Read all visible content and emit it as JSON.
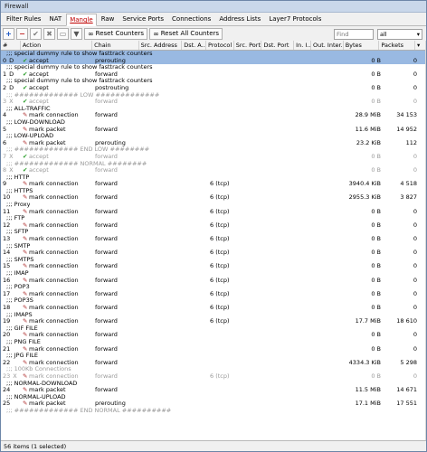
{
  "window": {
    "title": "Firewall"
  },
  "tabs": [
    "Filter Rules",
    "NAT",
    "Mangle",
    "Raw",
    "Service Ports",
    "Connections",
    "Address Lists",
    "Layer7 Protocols"
  ],
  "active_tab": "Mangle",
  "toolbar": {
    "reset_counters": "Reset Counters",
    "reset_all_counters": "Reset All Counters",
    "find_placeholder": "Find",
    "filter_value": "all"
  },
  "columns": [
    "#",
    "Action",
    "Chain",
    "Src. Address",
    "Dst. A...",
    "Protocol",
    "Src. Port",
    "Dst. Port",
    "In. I...",
    "Out. Inter...",
    "Bytes",
    "Packets"
  ],
  "rows": [
    {
      "type": "comment",
      "text": ";;; special dummy rule to show fasttrack counters",
      "selected": true
    },
    {
      "type": "rule",
      "num": "0",
      "flag": "D",
      "icon": "check",
      "action": "accept",
      "chain": "prerouting",
      "proto": "",
      "bytes": "0 B",
      "packets": "0",
      "selected": true
    },
    {
      "type": "comment",
      "text": ";;; special dummy rule to show fasttrack counters"
    },
    {
      "type": "rule",
      "num": "1",
      "flag": "D",
      "icon": "check",
      "action": "accept",
      "chain": "forward",
      "proto": "",
      "bytes": "0 B",
      "packets": "0"
    },
    {
      "type": "comment",
      "text": ";;; special dummy rule to show fasttrack counters"
    },
    {
      "type": "rule",
      "num": "2",
      "flag": "D",
      "icon": "check",
      "action": "accept",
      "chain": "postrouting",
      "proto": "",
      "bytes": "0 B",
      "packets": "0"
    },
    {
      "type": "comment",
      "text": ";;; ############# LOW #############",
      "disabled": true
    },
    {
      "type": "rule",
      "num": "3",
      "flag": "X",
      "icon": "check",
      "action": "accept",
      "chain": "forward",
      "proto": "",
      "bytes": "0 B",
      "packets": "0",
      "disabled": true
    },
    {
      "type": "comment",
      "text": ";;; ALL-TRAFFIC"
    },
    {
      "type": "rule",
      "num": "4",
      "flag": "",
      "icon": "pen",
      "action": "mark connection",
      "chain": "forward",
      "proto": "",
      "bytes": "28.9 MiB",
      "packets": "34 153"
    },
    {
      "type": "comment",
      "text": ";;; LOW-DOWNLOAD"
    },
    {
      "type": "rule",
      "num": "5",
      "flag": "",
      "icon": "pen",
      "action": "mark packet",
      "chain": "forward",
      "proto": "",
      "bytes": "11.6 MiB",
      "packets": "14 952"
    },
    {
      "type": "comment",
      "text": ";;; LOW-UPLOAD"
    },
    {
      "type": "rule",
      "num": "6",
      "flag": "",
      "icon": "pen",
      "action": "mark packet",
      "chain": "prerouting",
      "proto": "",
      "bytes": "23.2 KiB",
      "packets": "112"
    },
    {
      "type": "comment",
      "text": ";;; ############# END LOW ########",
      "disabled": true
    },
    {
      "type": "rule",
      "num": "7",
      "flag": "X",
      "icon": "check",
      "action": "accept",
      "chain": "forward",
      "proto": "",
      "bytes": "0 B",
      "packets": "0",
      "disabled": true
    },
    {
      "type": "comment",
      "text": ";;; ############# NORMAL ########",
      "disabled": true
    },
    {
      "type": "rule",
      "num": "8",
      "flag": "X",
      "icon": "check",
      "action": "accept",
      "chain": "forward",
      "proto": "",
      "bytes": "0 B",
      "packets": "0",
      "disabled": true
    },
    {
      "type": "comment",
      "text": ";;; HTTP"
    },
    {
      "type": "rule",
      "num": "9",
      "flag": "",
      "icon": "pen",
      "action": "mark connection",
      "chain": "forward",
      "proto": "6 (tcp)",
      "bytes": "3940.4 KiB",
      "packets": "4 518"
    },
    {
      "type": "comment",
      "text": ";;; HTTPS"
    },
    {
      "type": "rule",
      "num": "10",
      "flag": "",
      "icon": "pen",
      "action": "mark connection",
      "chain": "forward",
      "proto": "6 (tcp)",
      "bytes": "2955.3 KiB",
      "packets": "3 827"
    },
    {
      "type": "comment",
      "text": ";;; Proxy"
    },
    {
      "type": "rule",
      "num": "11",
      "flag": "",
      "icon": "pen",
      "action": "mark connection",
      "chain": "forward",
      "proto": "6 (tcp)",
      "bytes": "0 B",
      "packets": "0"
    },
    {
      "type": "comment",
      "text": ";;; FTP"
    },
    {
      "type": "rule",
      "num": "12",
      "flag": "",
      "icon": "pen",
      "action": "mark connection",
      "chain": "forward",
      "proto": "6 (tcp)",
      "bytes": "0 B",
      "packets": "0"
    },
    {
      "type": "comment",
      "text": ";;; SFTP"
    },
    {
      "type": "rule",
      "num": "13",
      "flag": "",
      "icon": "pen",
      "action": "mark connection",
      "chain": "forward",
      "proto": "6 (tcp)",
      "bytes": "0 B",
      "packets": "0"
    },
    {
      "type": "comment",
      "text": ";;; SMTP"
    },
    {
      "type": "rule",
      "num": "14",
      "flag": "",
      "icon": "pen",
      "action": "mark connection",
      "chain": "forward",
      "proto": "6 (tcp)",
      "bytes": "0 B",
      "packets": "0"
    },
    {
      "type": "comment",
      "text": ";;; SMTPS"
    },
    {
      "type": "rule",
      "num": "15",
      "flag": "",
      "icon": "pen",
      "action": "mark connection",
      "chain": "forward",
      "proto": "6 (tcp)",
      "bytes": "0 B",
      "packets": "0"
    },
    {
      "type": "comment",
      "text": ";;; IMAP"
    },
    {
      "type": "rule",
      "num": "16",
      "flag": "",
      "icon": "pen",
      "action": "mark connection",
      "chain": "forward",
      "proto": "6 (tcp)",
      "bytes": "0 B",
      "packets": "0"
    },
    {
      "type": "comment",
      "text": ";;; POP3"
    },
    {
      "type": "rule",
      "num": "17",
      "flag": "",
      "icon": "pen",
      "action": "mark connection",
      "chain": "forward",
      "proto": "6 (tcp)",
      "bytes": "0 B",
      "packets": "0"
    },
    {
      "type": "comment",
      "text": ";;; POP3S"
    },
    {
      "type": "rule",
      "num": "18",
      "flag": "",
      "icon": "pen",
      "action": "mark connection",
      "chain": "forward",
      "proto": "6 (tcp)",
      "bytes": "0 B",
      "packets": "0"
    },
    {
      "type": "comment",
      "text": ";;; IMAPS"
    },
    {
      "type": "rule",
      "num": "19",
      "flag": "",
      "icon": "pen",
      "action": "mark connection",
      "chain": "forward",
      "proto": "6 (tcp)",
      "bytes": "17.7 MiB",
      "packets": "18 610"
    },
    {
      "type": "comment",
      "text": ";;; GIF FILE"
    },
    {
      "type": "rule",
      "num": "20",
      "flag": "",
      "icon": "pen",
      "action": "mark connection",
      "chain": "forward",
      "proto": "",
      "bytes": "0 B",
      "packets": "0"
    },
    {
      "type": "comment",
      "text": ";;; PNG FILE"
    },
    {
      "type": "rule",
      "num": "21",
      "flag": "",
      "icon": "pen",
      "action": "mark connection",
      "chain": "forward",
      "proto": "",
      "bytes": "0 B",
      "packets": "0"
    },
    {
      "type": "comment",
      "text": ";;; JPG FILE"
    },
    {
      "type": "rule",
      "num": "22",
      "flag": "",
      "icon": "pen",
      "action": "mark connection",
      "chain": "forward",
      "proto": "",
      "bytes": "4334.3 KiB",
      "packets": "5 298"
    },
    {
      "type": "comment",
      "text": ";;; 100Kb Connections",
      "disabled": true
    },
    {
      "type": "rule",
      "num": "23",
      "flag": "X",
      "icon": "pen",
      "action": "mark connection",
      "chain": "forward",
      "proto": "6 (tcp)",
      "bytes": "0 B",
      "packets": "0",
      "disabled": true
    },
    {
      "type": "comment",
      "text": ";;; NORMAL-DOWNLOAD"
    },
    {
      "type": "rule",
      "num": "24",
      "flag": "",
      "icon": "pen",
      "action": "mark packet",
      "chain": "forward",
      "proto": "",
      "bytes": "11.5 MiB",
      "packets": "14 671"
    },
    {
      "type": "comment",
      "text": ";;; NORMAL-UPLOAD"
    },
    {
      "type": "rule",
      "num": "25",
      "flag": "",
      "icon": "pen",
      "action": "mark packet",
      "chain": "prerouting",
      "proto": "",
      "bytes": "17.1 MiB",
      "packets": "17 551"
    },
    {
      "type": "comment",
      "text": ";;; ############# END NORMAL ##########",
      "disabled": true
    }
  ],
  "status": "56 items (1 selected)"
}
